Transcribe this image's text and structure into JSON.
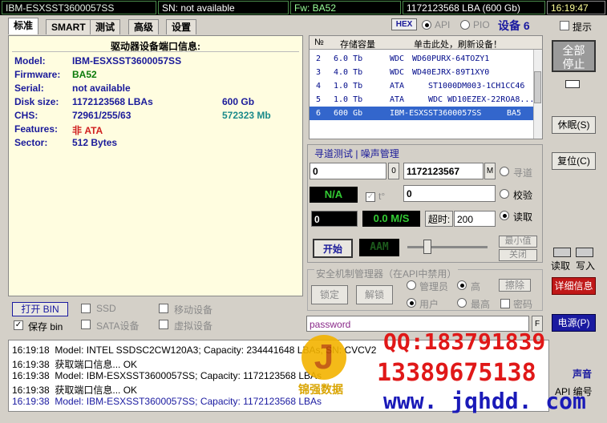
{
  "status": {
    "model": "IBM-ESXSST3600057SS",
    "sn": "SN: not available",
    "fw": "Fw: BA52",
    "lba": "1172123568 LBA (600 Gb)",
    "time": "16:19:47"
  },
  "toolbar": {
    "hex": "HEX",
    "api": "API",
    "pio": "PIO",
    "device": "设备 6",
    "hint": "提示"
  },
  "tabs": [
    "标准",
    "SMART",
    "测试",
    "高级",
    "设置"
  ],
  "info": {
    "heading": "驱动器设备端口信息:",
    "rows": [
      {
        "label": "Model:",
        "value": "IBM-ESXSST3600057SS",
        "extra": ""
      },
      {
        "label": "Firmware:",
        "value": "BA52",
        "extra": ""
      },
      {
        "label": "Serial:",
        "value": "not available",
        "extra": ""
      },
      {
        "label": "Disk size:",
        "value": "1172123568 LBAs",
        "extra": "600 Gb"
      },
      {
        "label": "CHS:",
        "value": "72961/255/63",
        "extra": "572323 Mb"
      },
      {
        "label": "Features:",
        "value": "非 ATA",
        "extra": ""
      },
      {
        "label": "Sector:",
        "value": "512 Bytes",
        "extra": ""
      }
    ],
    "colors": {
      "label": "#1a1a9a",
      "firmware": "#0a7a0a",
      "features": "#d02020",
      "mb": "#1a8a8a"
    }
  },
  "disk_list": {
    "headers": [
      "№",
      "存储容量",
      "单击此处，刷新设备！"
    ],
    "rows": [
      {
        "n": "2",
        "size": "6.0 Tb",
        "type": "WDC",
        "model": "WD60PURX-64TOZY1"
      },
      {
        "n": "3",
        "size": "4.0 Tb",
        "type": "WDC",
        "model": "WD40EJRX-89T1XY0"
      },
      {
        "n": "4",
        "size": "1.0 Tb",
        "type": "ATA",
        "model": "ST1000DM003-1CH1CC46"
      },
      {
        "n": "5",
        "size": "1.0 Tb",
        "type": "ATA",
        "model": "WDC WD10EZEX-22ROA8..."
      },
      {
        "n": "6",
        "size": "600 Gb",
        "type": "IBM-ESXSST3600057SS",
        "model": "BA5"
      }
    ]
  },
  "seek": {
    "title": "寻道测试 | 噪声管理",
    "start": "0",
    "start_unit": "0",
    "end": "1172123567",
    "end_unit": "M",
    "na": "N/A",
    "temp_icon": "t°",
    "value2": "0",
    "counter": "0",
    "speed": "0.0 M/S",
    "timeout_label": "超时:",
    "timeout": "200",
    "opt_seek": "寻道",
    "opt_verify": "校验",
    "opt_read": "读取",
    "start_btn": "开始",
    "aam": "AAM",
    "min_btn": "最小值",
    "off_btn": "关闭"
  },
  "security": {
    "title": "安全机制管理器（在API中禁用）",
    "lock": "锁定",
    "unlock": "解锁",
    "admin": "管理员",
    "high": "高",
    "erase": "擦除",
    "user": "用户",
    "max": "最高",
    "password_chk": "密码",
    "password_value": "password"
  },
  "bottom_left": {
    "open_bin": "打开 BIN",
    "save_bin": "保存 bin",
    "ssd": "SSD",
    "mobile": "移动设备",
    "sata": "SATA设备",
    "virtual": "虚拟设备"
  },
  "side": {
    "stop_all": "全部\n停止",
    "sleep": "休眠(S)",
    "reset": "复位(C)",
    "read": "读取",
    "write": "写入",
    "details": "详细信息",
    "power": "电源(P)",
    "sound": "声音",
    "api_num": "API 编号"
  },
  "log": [
    {
      "time": "16:19:18",
      "text": "Model: INTEL SSDSC2CW120A3; Capacity: 234441648 LBAs; SN: CVCV2",
      "blue": false
    },
    {
      "time": "16:19:38",
      "text": "获取端口信息... OK",
      "blue": false
    },
    {
      "time": "16:19:38",
      "text": "Model: IBM-ESXSST3600057SS; Capacity: 1172123568 LBAs",
      "blue": false
    },
    {
      "time": "16:19:38",
      "text": "获取端口信息... OK",
      "blue": false
    },
    {
      "time": "16:19:38",
      "text": "Model: IBM-ESXSST3600057SS; Capacity: 1172123568 LBAs",
      "blue": true
    }
  ],
  "watermark": {
    "qq": "QQ:183791839",
    "phone": "13389675138",
    "url": "www. jqhdd. com",
    "brand": "锦强数据",
    "logo_letter": "J"
  }
}
